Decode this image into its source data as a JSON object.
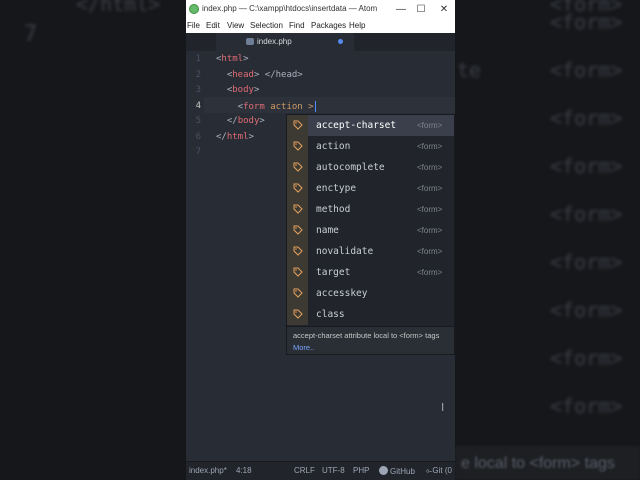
{
  "background": {
    "left_fragments": [
      "</html>",
      "7"
    ],
    "right_fragments": [
      "<form>",
      "<form>",
      "te",
      "<form>",
      "<form>",
      "<form>",
      "<form>",
      "<form>",
      "<form>",
      "<form>",
      "<form>"
    ],
    "bottom_caption": "e local to <form> tags"
  },
  "window": {
    "title": "index.php — C:\\xampp\\htdocs\\insertdata — Atom",
    "controls": {
      "minimize": "—",
      "maximize": "☐",
      "close": "✕"
    },
    "menu": [
      "File",
      "Edit",
      "View",
      "Selection",
      "Find",
      "Packages",
      "Help"
    ]
  },
  "tab": {
    "label": "index.php",
    "modified": true
  },
  "editor": {
    "line_numbers": [
      "1",
      "2",
      "3",
      "4",
      "5",
      "6",
      "7"
    ],
    "active_line": "4",
    "lines": [
      {
        "open": "<",
        "name": "html",
        "close": ">",
        "rest": ""
      },
      {
        "open": "  <",
        "name": "head",
        "close": ">",
        "rest": " </head>"
      },
      {
        "open": "  <",
        "name": "body",
        "close": ">",
        "rest": ""
      },
      {
        "open": "    <",
        "name": "form",
        "close": "",
        "rest": " action >"
      },
      {
        "open": "  </",
        "name": "body",
        "close": ">",
        "rest": ""
      },
      {
        "open": "</",
        "name": "html",
        "close": ">",
        "rest": ""
      },
      {
        "open": "",
        "name": "",
        "close": "",
        "rest": ""
      }
    ]
  },
  "autocomplete": {
    "items": [
      {
        "label": "accept-charset",
        "right": "<form>",
        "selected": true
      },
      {
        "label": "action",
        "right": "<form>"
      },
      {
        "label": "autocomplete",
        "right": "<form>"
      },
      {
        "label": "enctype",
        "right": "<form>"
      },
      {
        "label": "method",
        "right": "<form>"
      },
      {
        "label": "name",
        "right": "<form>"
      },
      {
        "label": "novalidate",
        "right": "<form>"
      },
      {
        "label": "target",
        "right": "<form>"
      },
      {
        "label": "accesskey",
        "right": ""
      },
      {
        "label": "class",
        "right": ""
      }
    ],
    "description": "accept-charset attribute local to <form> tags",
    "more": "More.."
  },
  "statusbar": {
    "file": "index.php*",
    "position": "4:18",
    "line_ending": "CRLF",
    "encoding": "UTF-8",
    "grammar": "PHP",
    "github": "GitHub",
    "git": "Git (0"
  },
  "colors": {
    "editor_bg": "#282c34",
    "tag": "#e06c75",
    "attribute": "#d19a66",
    "accent": "#568af2"
  }
}
